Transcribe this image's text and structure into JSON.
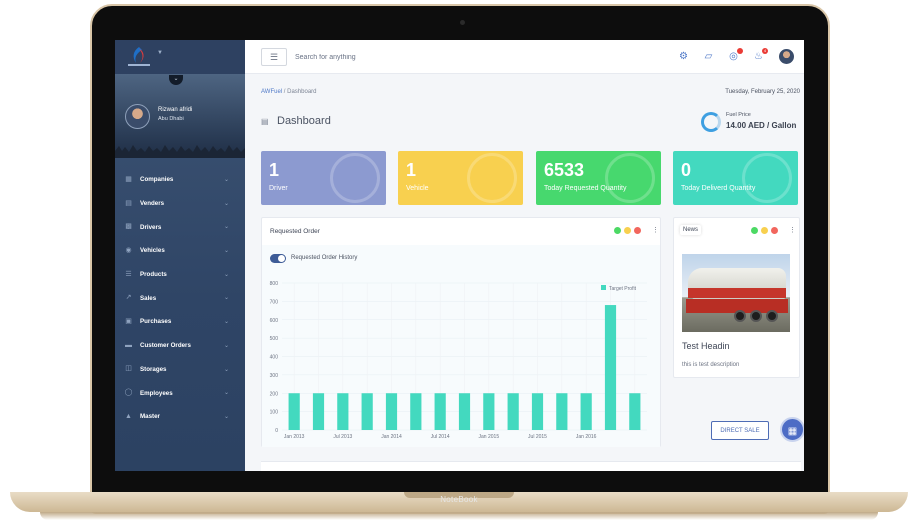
{
  "device": {
    "label": "NoteBook"
  },
  "sidebar": {
    "user": {
      "name": "Rizwan afridi",
      "location": "Abu Dhabi"
    },
    "items": [
      {
        "label": "Companies",
        "icon": "building-icon"
      },
      {
        "label": "Venders",
        "icon": "store-icon"
      },
      {
        "label": "Drivers",
        "icon": "id-card-icon"
      },
      {
        "label": "Vehicles",
        "icon": "car-icon"
      },
      {
        "label": "Products",
        "icon": "list-icon"
      },
      {
        "label": "Sales",
        "icon": "chart-line-icon"
      },
      {
        "label": "Purchases",
        "icon": "cart-icon"
      },
      {
        "label": "Customer Orders",
        "icon": "orders-icon"
      },
      {
        "label": "Storages",
        "icon": "storage-icon"
      },
      {
        "label": "Employees",
        "icon": "user-icon"
      },
      {
        "label": "Master",
        "icon": "bank-icon"
      }
    ]
  },
  "header": {
    "search_placeholder": "Search for anything",
    "notification_count": "4"
  },
  "breadcrumb": {
    "root": "AWFuel",
    "separator": "/",
    "current": "Dashboard"
  },
  "date": "Tuesday, February 25, 2020",
  "page_title": "Dashboard",
  "fuel": {
    "label": "Fuel Price",
    "value": "14.00 AED / Gallon"
  },
  "stats": [
    {
      "value": "1",
      "label": "Driver",
      "color": "#8c9ad0"
    },
    {
      "value": "1",
      "label": "Vehicle",
      "color": "#f8d04f"
    },
    {
      "value": "6533",
      "label": "Today Requested Quantity",
      "color": "#47d86e"
    },
    {
      "value": "0",
      "label": "Today Deliverd Quantity",
      "color": "#43d9bf"
    }
  ],
  "requested_order": {
    "title": "Requested Order",
    "toggle_label": "Requested Order History"
  },
  "chart_data": {
    "type": "bar",
    "categories": [
      "Jan 2013",
      "",
      "Jul 2013",
      "",
      "Jan 2014",
      "",
      "Jul 2014",
      "",
      "Jan 2015",
      "",
      "Jul 2015",
      "",
      "Jan 2016",
      "",
      ""
    ],
    "series": [
      {
        "name": "Target Profit",
        "values": [
          200,
          200,
          200,
          200,
          200,
          200,
          200,
          200,
          200,
          200,
          200,
          200,
          200,
          680,
          200
        ]
      }
    ],
    "ylim": [
      0,
      800
    ],
    "yticks": [
      0,
      100,
      200,
      300,
      400,
      500,
      600,
      700,
      800
    ],
    "grid": true,
    "legend": "top-right",
    "color": "#43d9bf"
  },
  "news": {
    "tag": "News",
    "heading": "Test Headin",
    "description": "this is test description"
  },
  "buttons": {
    "direct_sale": "DIRECT SALE"
  },
  "colors": {
    "dot_green": "#4cd964",
    "dot_yellow": "#f8d04f",
    "dot_red": "#f2665d",
    "accent": "#4d6cc5"
  }
}
